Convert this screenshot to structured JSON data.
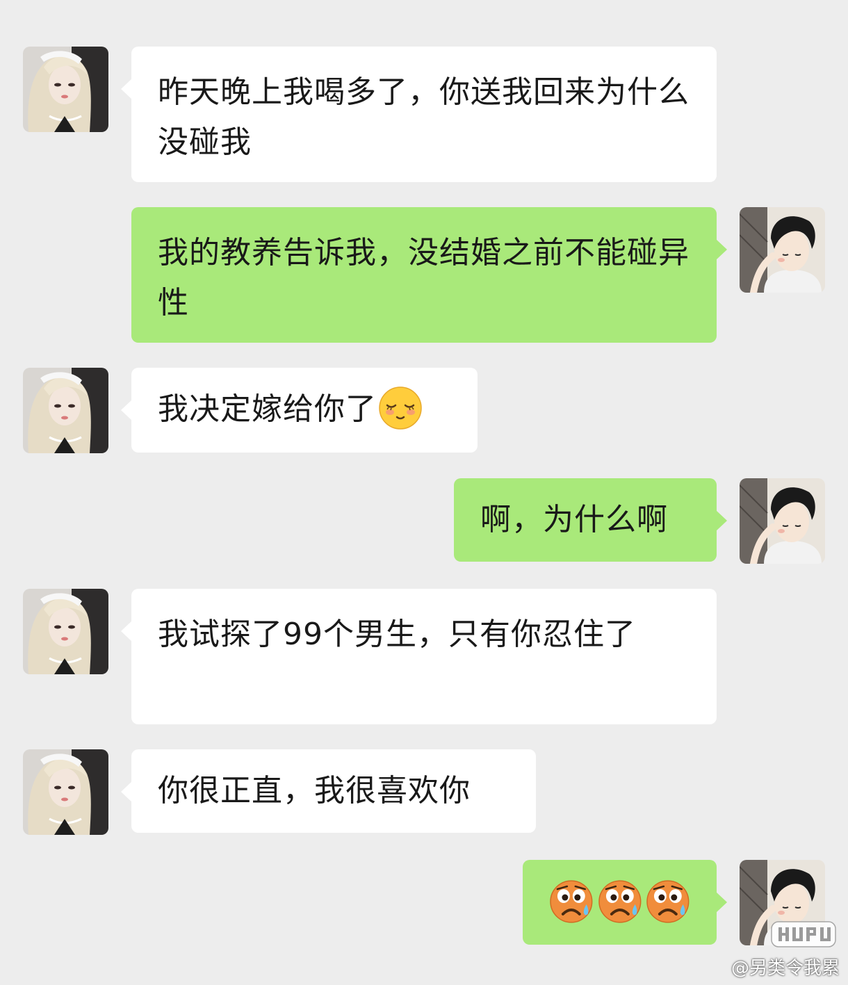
{
  "chat": {
    "messages": [
      {
        "from": "other",
        "text": "昨天晚上我喝多了，你送我回来为什么没碰我"
      },
      {
        "from": "me",
        "text": "我的教养告诉我，没结婚之前不能碰异性"
      },
      {
        "from": "other",
        "text": "我决定嫁给你了",
        "emoji": "shy-smile-emoji"
      },
      {
        "from": "me",
        "text": "啊，为什么啊"
      },
      {
        "from": "other",
        "text": "我试探了99个男生，只有你忍住了"
      },
      {
        "from": "other",
        "text": "你很正直，我很喜欢你"
      },
      {
        "from": "me",
        "text": "",
        "emojis": [
          "sweat-frown-emoji",
          "sweat-frown-emoji",
          "sweat-frown-emoji"
        ]
      }
    ]
  },
  "colors": {
    "background": "#ededed",
    "incoming_bubble": "#ffffff",
    "outgoing_bubble": "#a9e97a"
  },
  "watermark": {
    "logo": "HUPU",
    "credit": "@另类令我累"
  }
}
